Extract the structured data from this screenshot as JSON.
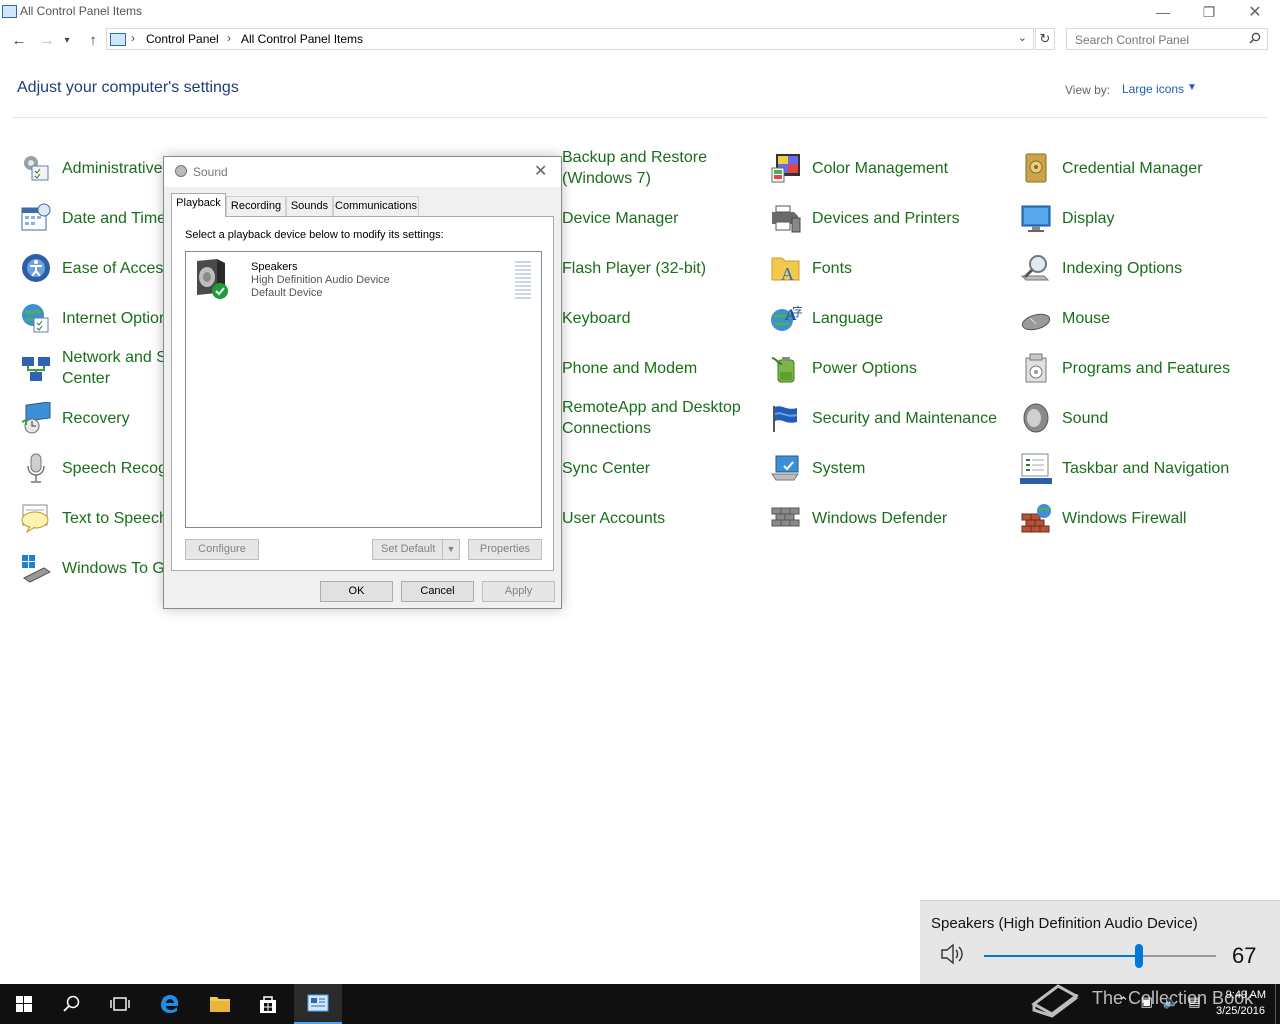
{
  "window": {
    "title": "All Control Panel Items"
  },
  "address": {
    "crumbs": [
      "Control Panel",
      "All Control Panel Items"
    ],
    "separator": "›"
  },
  "search": {
    "placeholder": "Search Control Panel"
  },
  "header": {
    "heading": "Adjust your computer's settings",
    "view_by_label": "View by:",
    "view_by_value": "Large icons"
  },
  "items": {
    "col1": [
      {
        "label": "Administrative",
        "icon": "tools-icon"
      },
      {
        "label": "Date and Time",
        "icon": "calendar-clock-icon"
      },
      {
        "label": "Ease of Access",
        "icon": "ease-of-access-icon"
      },
      {
        "label": "Internet Optior",
        "icon": "internet-options-icon"
      },
      {
        "label": "Network and S",
        "label2": "Center",
        "icon": "network-icon"
      },
      {
        "label": "Recovery",
        "icon": "recovery-icon"
      },
      {
        "label": "Speech Recogr",
        "icon": "microphone-icon"
      },
      {
        "label": "Text to Speech",
        "icon": "speech-bubble-icon"
      },
      {
        "label": "Windows To Go",
        "icon": "usb-drive-icon"
      }
    ],
    "col3": [
      {
        "label": "Backup and Restore",
        "label2": "(Windows 7)",
        "icon": "backup-icon"
      },
      {
        "label": "Device Manager",
        "icon": "device-manager-icon"
      },
      {
        "label": "Flash Player (32-bit)",
        "icon": "flash-icon"
      },
      {
        "label": "Keyboard",
        "icon": "keyboard-icon"
      },
      {
        "label": "Phone and Modem",
        "icon": "phone-icon"
      },
      {
        "label": "RemoteApp and Desktop",
        "label2": "Connections",
        "icon": "remote-icon"
      },
      {
        "label": "Sync Center",
        "icon": "sync-icon"
      },
      {
        "label": "User Accounts",
        "icon": "user-icon"
      }
    ],
    "col4": [
      {
        "label": "Color Management",
        "icon": "color-management-icon"
      },
      {
        "label": "Devices and Printers",
        "icon": "printer-icon"
      },
      {
        "label": "Fonts",
        "icon": "fonts-folder-icon"
      },
      {
        "label": "Language",
        "icon": "language-icon"
      },
      {
        "label": "Power Options",
        "icon": "battery-icon"
      },
      {
        "label": "Security and Maintenance",
        "icon": "flag-icon"
      },
      {
        "label": "System",
        "icon": "system-icon"
      },
      {
        "label": "Windows Defender",
        "icon": "wall-icon"
      }
    ],
    "col5": [
      {
        "label": "Credential Manager",
        "icon": "vault-icon"
      },
      {
        "label": "Display",
        "icon": "monitor-icon"
      },
      {
        "label": "Indexing Options",
        "icon": "magnifier-icon"
      },
      {
        "label": "Mouse",
        "icon": "mouse-icon"
      },
      {
        "label": "Programs and Features",
        "icon": "programs-icon"
      },
      {
        "label": "Sound",
        "icon": "speaker-icon"
      },
      {
        "label": "Taskbar and Navigation",
        "icon": "taskbar-icon"
      },
      {
        "label": "Windows Firewall",
        "icon": "firewall-icon"
      }
    ]
  },
  "dialog": {
    "title": "Sound",
    "tabs": [
      "Playback",
      "Recording",
      "Sounds",
      "Communications"
    ],
    "active_tab": "Playback",
    "instruction": "Select a playback device below to modify its settings:",
    "device": {
      "name": "Speakers",
      "description": "High Definition Audio Device",
      "status": "Default Device"
    },
    "buttons": {
      "configure": "Configure",
      "set_default": "Set Default",
      "properties": "Properties",
      "ok": "OK",
      "cancel": "Cancel",
      "apply": "Apply"
    }
  },
  "volume": {
    "device": "Speakers (High Definition Audio Device)",
    "level": 67
  },
  "taskbar": {
    "watermark": "The Collection Book",
    "time": "9:49 AM",
    "date": "3/25/2016"
  },
  "colors": {
    "link_green": "#1a6e1a",
    "heading_blue": "#1e3f7a",
    "accent": "#0078d7"
  }
}
